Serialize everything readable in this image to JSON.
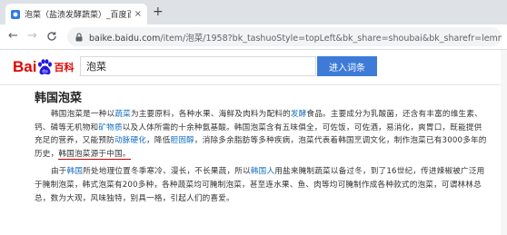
{
  "browser": {
    "tab_title": "泡菜（盐渍发酵蔬菜）_百度百科",
    "tab_close": "×",
    "new_tab": "+",
    "back": "←",
    "forward": "→",
    "reload": "C",
    "url_host": "baike.baidu.com",
    "url_path": "/item/泡菜/1958?bk_tashuoStyle=topLeft&bk_share=shoubai&bk_sharefr=lemma"
  },
  "baike": {
    "logo_left": "Bai",
    "logo_right": "百科",
    "search_value": "泡菜",
    "enter_button": "进入词条"
  },
  "article": {
    "title": "韩国泡菜",
    "p1": {
      "s1": "韩国泡菜是一种以",
      "link_vegetable": "蔬菜",
      "s2": "为主要原料，各种水果、海鲜及肉料为配料的",
      "link_ferment": "发酵",
      "s3": "食品。主要成分为乳酸菌，还含有丰富的维生素、钙、磷等无机物和",
      "link_mineral": "矿物质",
      "s4": "以及人体所需的十余种氨基酸。韩国泡菜含有五味俱全，可佐饭，可佐酒，易消化，爽胃口，既能提供充足的营养，又能预防",
      "link_arteriosclerosis": "动脉硬化",
      "s5": "，降低",
      "link_cholesterol": "胆固醇",
      "s6": "，消除多余脂肪等多种疾病，泡菜代表着韩国烹调文化，制作泡菜已有3000多年的历史，",
      "underlined": "韩国泡菜源于中国。"
    },
    "p2": {
      "s1": "由于",
      "link_korea": "韩国",
      "s2": "所处地理位置冬季寒冷、漫长，不长果蔬，所以",
      "link_koreans": "韩国人",
      "s3": "用盐来腌制蔬菜以备过冬，到了16世纪，传进辣椒被广泛用于腌制泡菜，韩式泡菜有200多种，各种蔬菜均可腌制泡菜，甚至连水果、鱼、肉等均可腌制作成各种款式的泡菜，可谓林林总总，数为大观，风味独特，别具一格，引起人们的喜爱。"
    }
  },
  "colors": {
    "baidu_red": "#e10602",
    "baidu_blue": "#2319dc",
    "button_blue": "#3e7bd8",
    "link_blue": "#136ec2",
    "underline_red": "#c00000"
  },
  "icons": [
    "baidu-baike-favicon",
    "lock-icon",
    "back-arrow-icon",
    "forward-arrow-icon",
    "reload-icon",
    "baidu-paw-icon"
  ]
}
